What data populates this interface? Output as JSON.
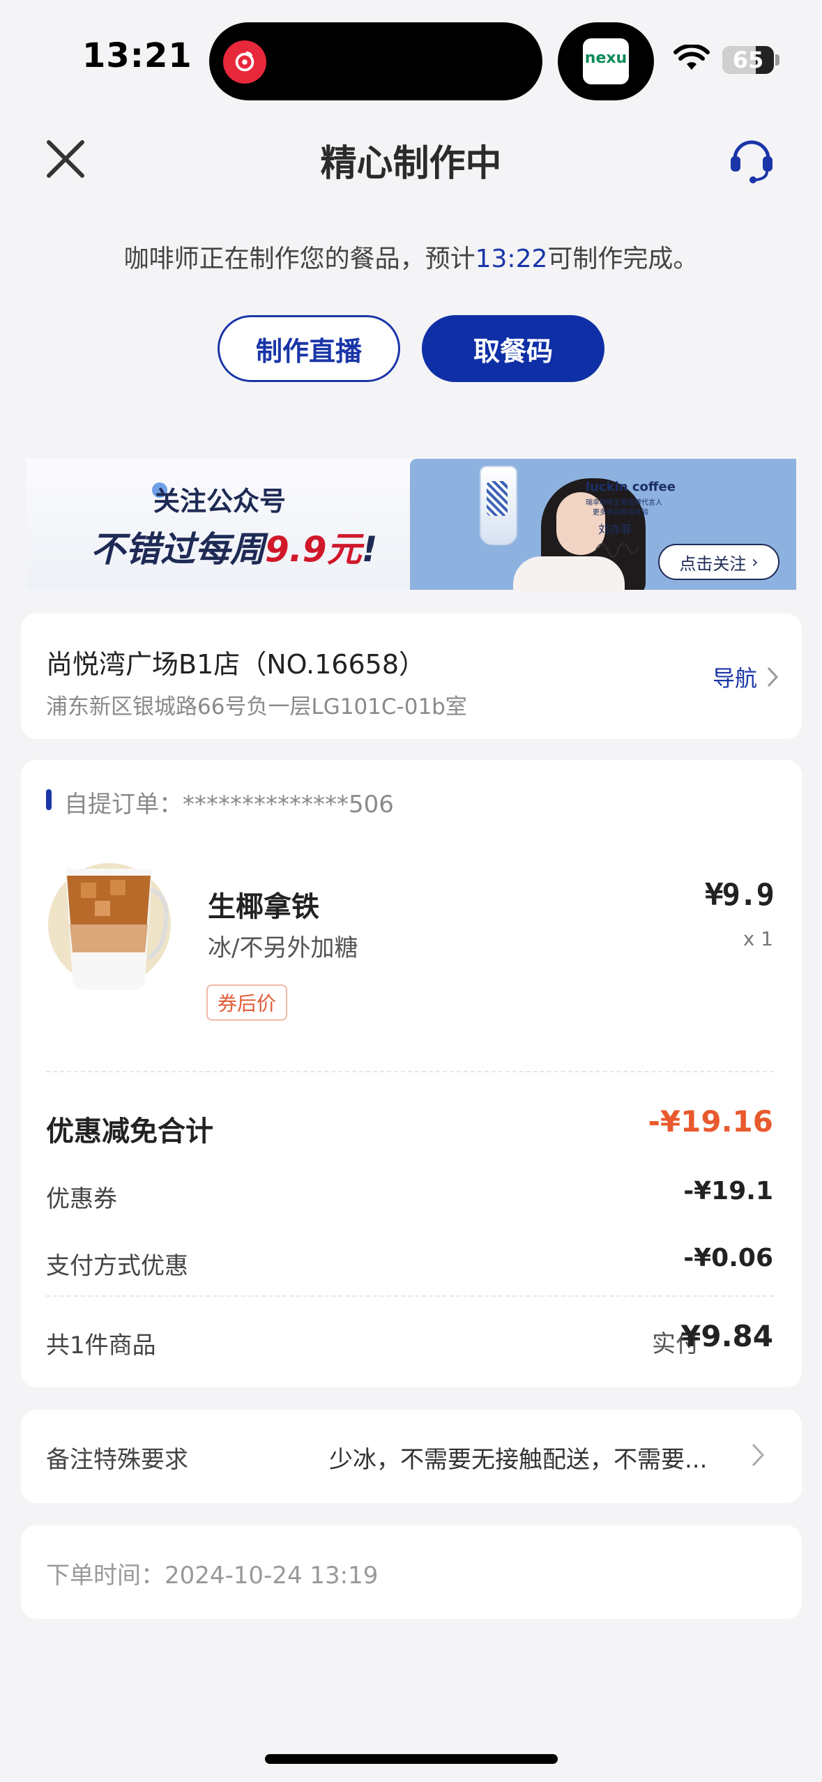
{
  "status_bar": {
    "time": "13:21",
    "battery": "65",
    "battery_level": 0.65,
    "app_badge": "nexu"
  },
  "header": {
    "title": "精心制作中"
  },
  "message": {
    "prefix": "咖啡师正在制作您的餐品，预计",
    "time": "13:22",
    "suffix": "可制作完成。"
  },
  "buttons": {
    "live": "制作直播",
    "pickup_code": "取餐码"
  },
  "banner": {
    "line1": "关注公众号",
    "line2_prefix": "不错过每周",
    "line2_price": "9.9元",
    "line2_suffix": "!",
    "brand": "luckin coffee",
    "brand_sub1": "瑞幸咖啡生椰品牌代言人",
    "brand_sub2": "更多新品惊喜体验",
    "endorser": "刘亦菲",
    "follow_button": "点击关注"
  },
  "store": {
    "name": "尚悦湾广场B1店（NO.16658）",
    "address": "浦东新区银城路66号负一层LG101C-01b室",
    "nav": "导航"
  },
  "order": {
    "label": "自提订单：",
    "number": "**************506",
    "item": {
      "name": "生椰拿铁",
      "options": "冰/不另外加糖",
      "tag": "券后价",
      "price": "¥9.9",
      "qty": "x 1"
    },
    "discount_title": "优惠减免合计",
    "discount_total": "-¥19.16",
    "rows": [
      {
        "label": "优惠券",
        "value": "-¥19.1"
      },
      {
        "label": "支付方式优惠",
        "value": "-¥0.06"
      }
    ],
    "count": "共1件商品",
    "paid_label": "实付",
    "paid_value": "¥9.84"
  },
  "note": {
    "label": "备注特殊要求",
    "value": "少冰，不需要无接触配送，不需要..."
  },
  "order_time": "下单时间：2024-10-24 13:19",
  "colors": {
    "accent": "#1a35a8",
    "discount": "#e85a2d",
    "background": "#f4f4f6"
  }
}
